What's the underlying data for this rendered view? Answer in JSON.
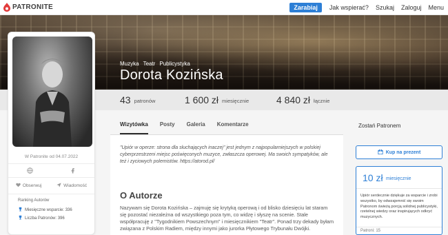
{
  "nav": {
    "logo_text": "PATRONITE",
    "support_button": "Zarabiaj",
    "links": [
      "Jak wspierać?",
      "Szukaj",
      "Zaloguj",
      "Menu"
    ]
  },
  "creator": {
    "categories": [
      "Muzyka",
      "Teatr",
      "Publicystyka"
    ],
    "name": "Dorota Kozińska"
  },
  "stats": [
    {
      "value": "43",
      "label": "patronów"
    },
    {
      "value": "1 600 zł",
      "label": "miesięcznie"
    },
    {
      "value": "4 840 zł",
      "label": "łącznie"
    }
  ],
  "profile": {
    "since": "W Patronite od 04.07.2022",
    "observe": "Obserwuj",
    "message": "Wiadomość",
    "ranking_title": "Ranking Autorów",
    "ranking_rows": [
      "Miesięczne wsparcie: 336",
      "Liczba Patronów: 396"
    ]
  },
  "tabs": [
    "Wizytówka",
    "Posty",
    "Galeria",
    "Komentarze"
  ],
  "content": {
    "quote": "\"Upiór w operze: strona dla słuchających inaczej\" jest jednym z najpopularniejszych w polskiej cyberprzestrzeni miejsc poświęconych muzyce, zwłaszcza operowej. Ma swoich sympatyków, ale też i zyciowych polemistów. https://atorod.pl/",
    "section_title": "O Autorze",
    "section_body": "Nazywam się Dorota Kozińska – zajmuję się krytyką operową i od blisko dziesięciu lat staram się pozostać niezależna od wszystkiego poza tym, co widzę i słyszę na scenie. Stale współpracuję z \"Tygodnikiem Powszechnym\" i miesięcznikiem \"Teatr\". Ponad trzy dekady byłam związana z Polskim Radiem, między innymi jako jurorka Płytowego Trybunału Dwójki."
  },
  "sidebar": {
    "become_patron": "Zostań Patronem",
    "gift_button": "Kup na prezent",
    "tier": {
      "price": "10 zł",
      "unit": "miesięcznie",
      "description": "Upiór serdecznie dziękuje za wsparcie i zrobi wszystko, by odwzajemnić się swoim Patronom świeżą porcją solidnej publicystyki, rzetelnej wiedzy oraz inspirujących odkryć muzycznych.",
      "patrons": "Patroni: 15"
    }
  },
  "colors": {
    "accent": "#2d7fd6",
    "brand_red": "#e23b3b"
  }
}
